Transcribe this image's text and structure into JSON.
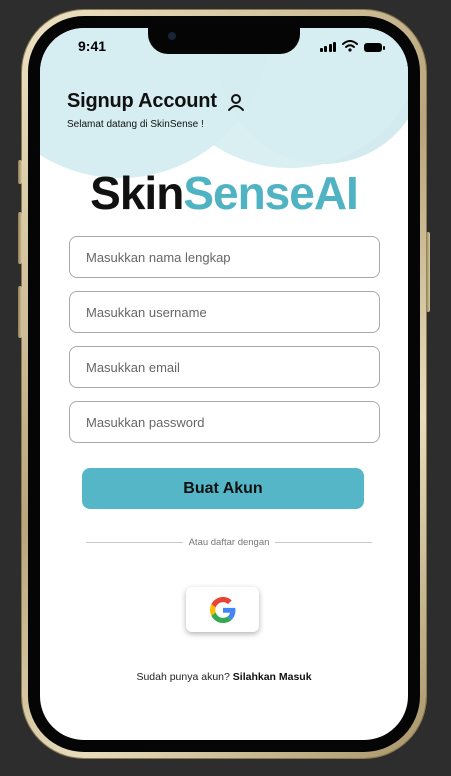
{
  "status_bar": {
    "time": "9:41",
    "icons": [
      "signal-icon",
      "wifi-icon",
      "battery-icon"
    ]
  },
  "header": {
    "title": "Signup Account",
    "title_icon": "user-icon",
    "subtitle": "Selamat datang di SkinSense !"
  },
  "logo": {
    "part1": "Skin",
    "part2": "SenseAI",
    "accent_color": "#4fb3c3"
  },
  "form": {
    "full_name_placeholder": "Masukkan nama lengkap",
    "username_placeholder": "Masukkan username",
    "email_placeholder": "Masukkan email",
    "password_placeholder": "Masukkan password",
    "submit_label": "Buat Akun"
  },
  "divider_text": "Atau daftar dengan",
  "social": {
    "google_icon": "google-icon"
  },
  "footer": {
    "prompt": "Sudah punya akun?",
    "link": "Silahkan Masuk"
  },
  "colors": {
    "primary": "#54b6c6",
    "background_deco": "#d6edf1"
  }
}
